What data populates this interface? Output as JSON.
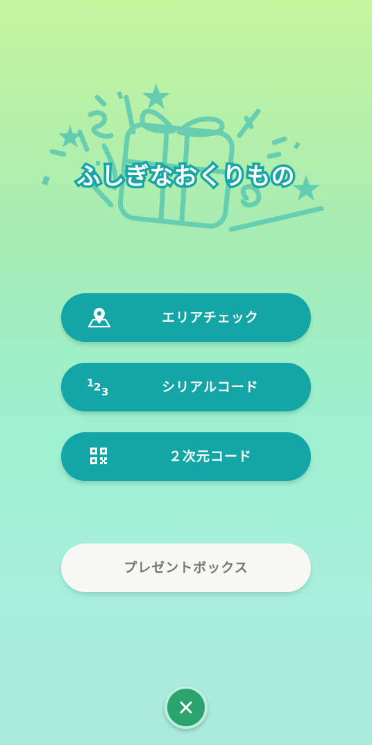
{
  "screen": {
    "title": "ふしぎなおくりもの"
  },
  "menu": {
    "area_check": {
      "label": "エリアチェック",
      "icon": "map-pin-icon"
    },
    "serial_code": {
      "label": "シリアルコード",
      "icon": "numbers-123-icon"
    },
    "qr_code": {
      "label": "２次元コード",
      "icon": "qr-code-icon"
    }
  },
  "present_box": {
    "label": "プレゼントボックス"
  },
  "close": {
    "icon": "close-icon"
  },
  "colors": {
    "accent": "#14a5a7",
    "title_outline": "#16a6a6",
    "close_button": "#2aa36c",
    "present_box_bg": "#f7f8f4"
  }
}
